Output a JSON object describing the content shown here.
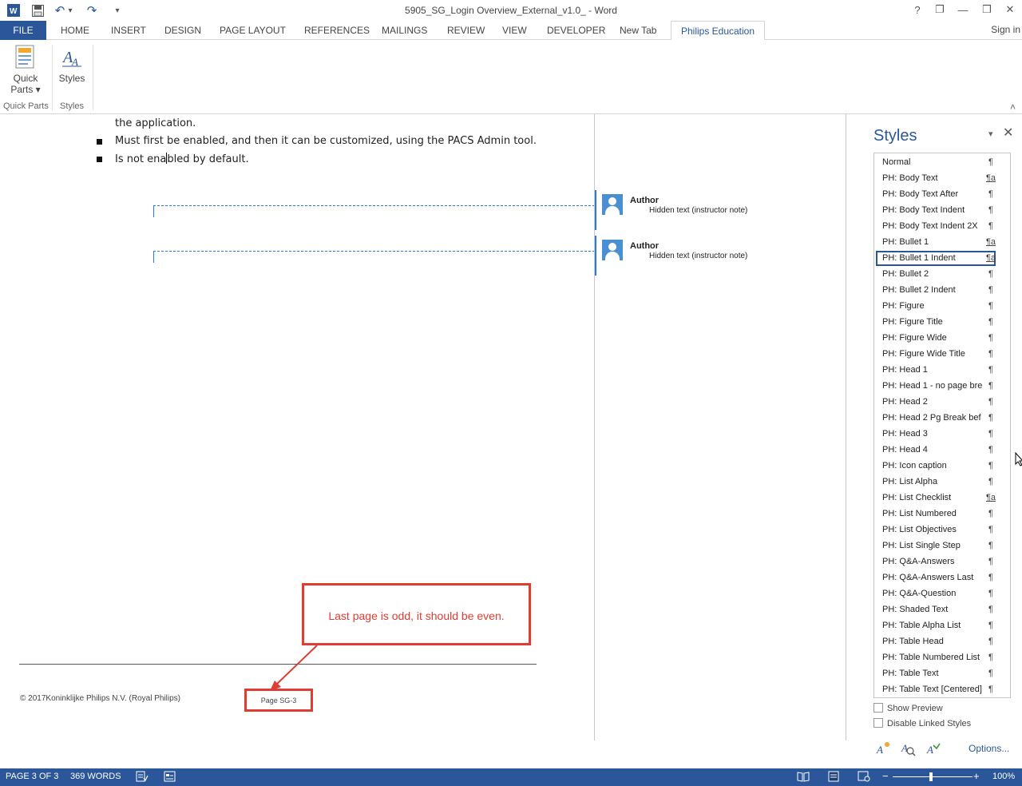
{
  "window": {
    "title": "5905_SG_Login Overview_External_v1.0_ - Word",
    "help": "?",
    "ribbon_display": "❐",
    "minimize": "—",
    "restore": "❒",
    "close": "✕"
  },
  "quick_access": {
    "word_icon": "W",
    "save_icon": "save-icon",
    "undo_icon": "↶",
    "undo_dropdown": "▾",
    "redo_icon": "↷",
    "customize": "▾"
  },
  "tabs": [
    {
      "label": "FILE"
    },
    {
      "label": "HOME"
    },
    {
      "label": "INSERT"
    },
    {
      "label": "DESIGN"
    },
    {
      "label": "PAGE LAYOUT"
    },
    {
      "label": "REFERENCES"
    },
    {
      "label": "MAILINGS"
    },
    {
      "label": "REVIEW"
    },
    {
      "label": "VIEW"
    },
    {
      "label": "DEVELOPER"
    },
    {
      "label": "New Tab"
    },
    {
      "label": "Philips Education"
    }
  ],
  "signin": "Sign in",
  "ribbon": {
    "quick_parts_label_1": "Quick",
    "quick_parts_label_2": "Parts ▾",
    "styles_label": "Styles",
    "group_quick_parts": "Quick Parts",
    "group_styles": "Styles",
    "collapse": "˄"
  },
  "document": {
    "line_partial": "the application.",
    "bullets": [
      "Must first be enabled, and then it can be customized, using the PACS Admin tool.",
      "Is not ena",
      "bled by default."
    ],
    "comments": [
      {
        "author": "Author",
        "text": "Hidden text (instructor note)"
      },
      {
        "author": "Author",
        "text": "Hidden text (instructor note)"
      }
    ],
    "footer_copyright": "© 2017Koninklijke Philips N.V. (Royal Philips)",
    "footer_page": "Page SG-3",
    "callout_text": "Last page is odd, it should be even.",
    "callout_color": "#e03c31"
  },
  "styles_pane": {
    "title": "Styles",
    "menu": "▾",
    "close": "✕",
    "items": [
      {
        "name": "Normal",
        "glyph": "¶"
      },
      {
        "name": "PH: Body Text",
        "glyph": "¶a"
      },
      {
        "name": "PH: Body Text After",
        "glyph": "¶"
      },
      {
        "name": "PH: Body Text Indent",
        "glyph": "¶"
      },
      {
        "name": "PH: Body Text Indent 2X",
        "glyph": "¶"
      },
      {
        "name": "PH: Bullet 1",
        "glyph": "¶a"
      },
      {
        "name": "PH: Bullet 1 Indent",
        "glyph": "¶a",
        "selected": true
      },
      {
        "name": "PH: Bullet 2",
        "glyph": "¶"
      },
      {
        "name": "PH: Bullet 2 Indent",
        "glyph": "¶"
      },
      {
        "name": "PH: Figure",
        "glyph": "¶"
      },
      {
        "name": "PH: Figure Title",
        "glyph": "¶"
      },
      {
        "name": "PH: Figure Wide",
        "glyph": "¶"
      },
      {
        "name": "PH: Figure Wide Title",
        "glyph": "¶"
      },
      {
        "name": "PH: Head 1",
        "glyph": "¶"
      },
      {
        "name": "PH: Head 1 - no page bre",
        "glyph": "¶"
      },
      {
        "name": "PH: Head 2",
        "glyph": "¶"
      },
      {
        "name": "PH: Head 2 Pg Break bef",
        "glyph": "¶"
      },
      {
        "name": "PH: Head 3",
        "glyph": "¶"
      },
      {
        "name": "PH: Head 4",
        "glyph": "¶"
      },
      {
        "name": "PH: Icon caption",
        "glyph": "¶"
      },
      {
        "name": "PH: List Alpha",
        "glyph": "¶"
      },
      {
        "name": "PH: List Checklist",
        "glyph": "¶a"
      },
      {
        "name": "PH: List Numbered",
        "glyph": "¶"
      },
      {
        "name": "PH: List Objectives",
        "glyph": "¶"
      },
      {
        "name": "PH: List Single Step",
        "glyph": "¶"
      },
      {
        "name": "PH: Q&A-Answers",
        "glyph": "¶"
      },
      {
        "name": "PH: Q&A-Answers Last",
        "glyph": "¶"
      },
      {
        "name": "PH: Q&A-Question",
        "glyph": "¶"
      },
      {
        "name": "PH: Shaded Text",
        "glyph": "¶"
      },
      {
        "name": "PH: Table Alpha List",
        "glyph": "¶"
      },
      {
        "name": "PH: Table Head",
        "glyph": "¶"
      },
      {
        "name": "PH: Table Numbered List",
        "glyph": "¶"
      },
      {
        "name": "PH: Table Text",
        "glyph": "¶"
      },
      {
        "name": "PH: Table Text [Centered]",
        "glyph": "¶"
      }
    ],
    "show_preview": "Show Preview",
    "disable_linked": "Disable Linked Styles",
    "new_style_icon": "new-style-icon",
    "style_inspector_icon": "style-inspector-icon",
    "manage_styles_icon": "manage-styles-icon",
    "options": "Options..."
  },
  "statusbar": {
    "page": "PAGE 3 OF 3",
    "words": "369 WORDS",
    "zoom": "100%",
    "zoom_minus": "−",
    "zoom_plus": "+"
  },
  "colors": {
    "accent": "#2b579a",
    "annotation": "#e03c31",
    "comment": "#2b7cd3"
  }
}
